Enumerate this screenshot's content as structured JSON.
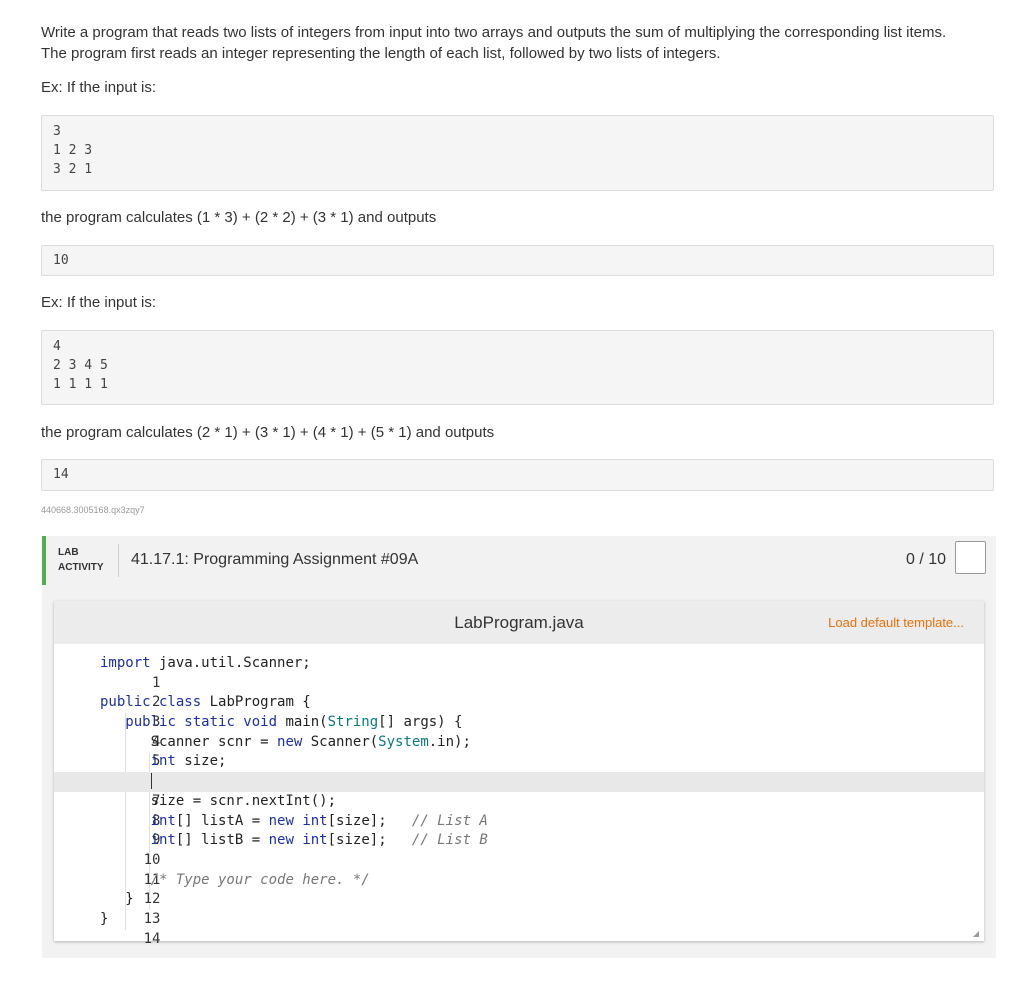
{
  "description": {
    "line1": "Write a program that reads two lists of integers from input into two arrays and outputs the sum of multiplying the corresponding list items.",
    "line2": "The program first reads an integer representing the length of each list, followed by two lists of integers."
  },
  "example1": {
    "intro": "Ex: If the input is:",
    "input_lines": [
      "3",
      "1 2 3",
      "3 2 1"
    ],
    "calc": "the program calculates (1 * 3) + (2 * 2) + (3 * 1) and outputs",
    "output": "10"
  },
  "example2": {
    "intro": "Ex: If the input is:",
    "input_lines": [
      "4",
      "2 3 4 5",
      "1 1 1 1"
    ],
    "calc": "the program calculates (2 * 1) + (3 * 1) + (4 * 1) + (5 * 1) and outputs",
    "output": "14"
  },
  "ident": "440668.3005168.qx3zqy7",
  "lab": {
    "tag_line1": "LAB",
    "tag_line2": "ACTIVITY",
    "title": "41.17.1: Programming Assignment #09A",
    "score": "0 / 10",
    "accent_color": "#4caf50"
  },
  "editor": {
    "filename": "LabProgram.java",
    "load_template": "Load default template...",
    "lines": [
      {
        "n": "1",
        "code": "import java.util.Scanner;"
      },
      {
        "n": "2",
        "code": ""
      },
      {
        "n": "3",
        "code": "public class LabProgram {"
      },
      {
        "n": "4",
        "code": "   public static void main(String[] args) {"
      },
      {
        "n": "5",
        "code": "      Scanner scnr = new Scanner(System.in);"
      },
      {
        "n": "6",
        "code": "      int size;"
      },
      {
        "n": "7",
        "code": "      "
      },
      {
        "n": "8",
        "code": "      size = scnr.nextInt();"
      },
      {
        "n": "9",
        "code": "      int[] listA = new int[size];   // List A"
      },
      {
        "n": "10",
        "code": "      int[] listB = new int[size];   // List B"
      },
      {
        "n": "11",
        "code": ""
      },
      {
        "n": "12",
        "code": "      /* Type your code here. */"
      },
      {
        "n": "13",
        "code": "   }"
      },
      {
        "n": "14",
        "code": "}"
      }
    ]
  }
}
